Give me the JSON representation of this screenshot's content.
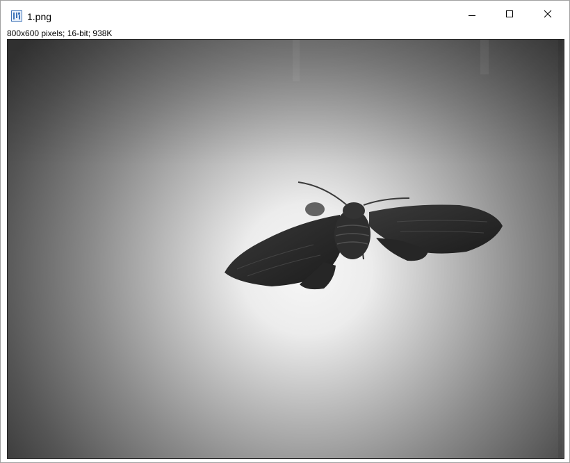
{
  "window": {
    "title": "1.png",
    "info": "800x600 pixels; 16-bit; 938K"
  },
  "controls": {
    "minimize_icon": "minimize-icon",
    "maximize_icon": "maximize-icon",
    "close_icon": "close-icon"
  },
  "image": {
    "subject": "moth",
    "colors": {
      "center": "#f6f6f6",
      "edge": "#3a3a3a",
      "moth": "#2a2a2a"
    }
  }
}
